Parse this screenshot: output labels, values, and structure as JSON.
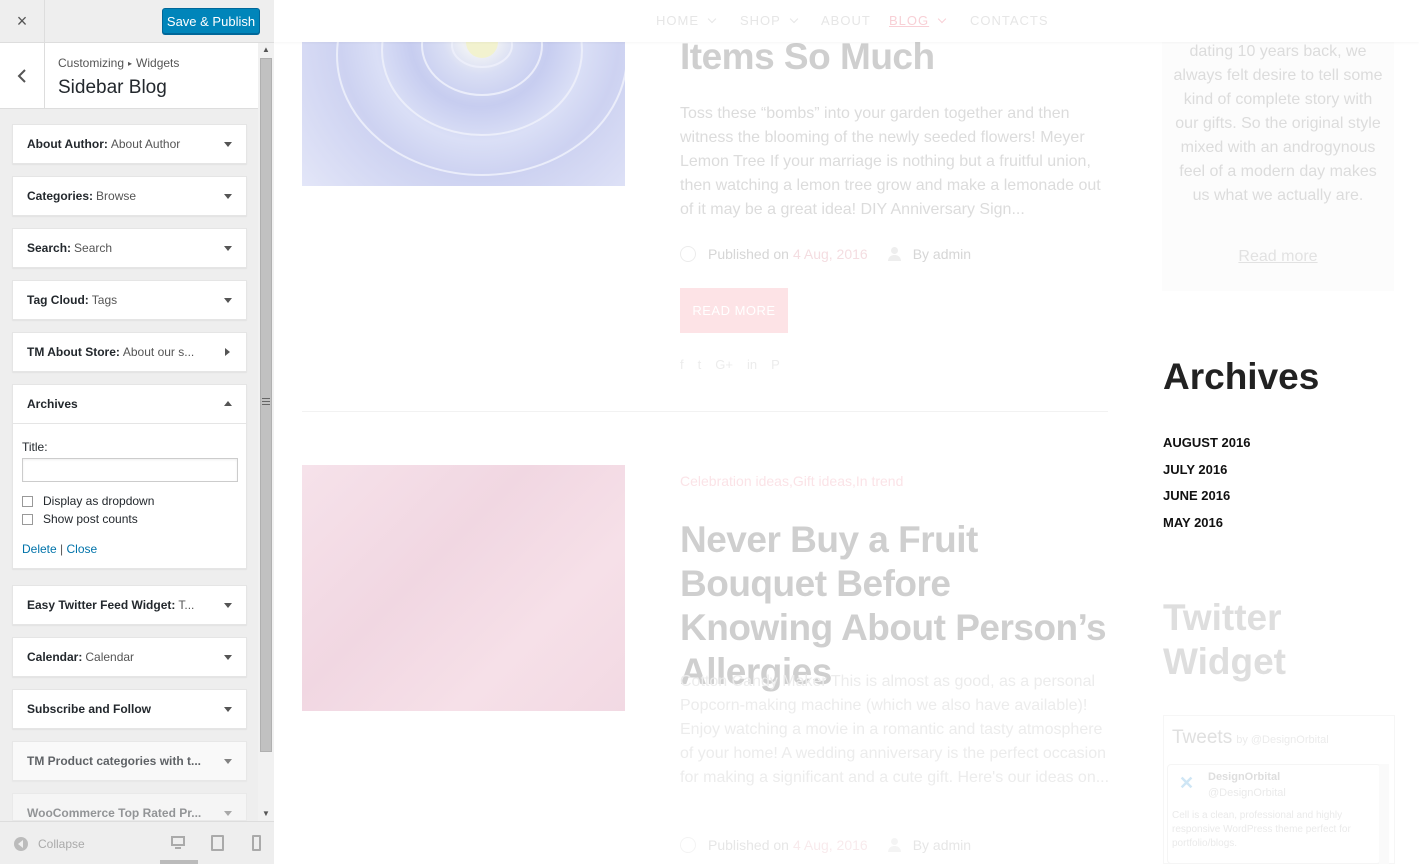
{
  "customizer": {
    "close_icon": "×",
    "publish_label": "Save & Publish",
    "breadcrumb": {
      "root": "Customizing",
      "separator": "▸",
      "current": "Widgets"
    },
    "section_title": "Sidebar Blog",
    "widgets": [
      {
        "name": "About Author:",
        "sub": "About Author",
        "state": "collapsed"
      },
      {
        "name": "Categories:",
        "sub": "Browse",
        "state": "collapsed"
      },
      {
        "name": "Search:",
        "sub": "Search",
        "state": "collapsed"
      },
      {
        "name": "Tag Cloud:",
        "sub": "Tags",
        "state": "collapsed"
      },
      {
        "name": "TM About Store:",
        "sub": "About our s...",
        "state": "right"
      },
      {
        "name": "Archives",
        "sub": "",
        "state": "expanded"
      },
      {
        "name": "Easy Twitter Feed Widget:",
        "sub": "T...",
        "state": "collapsed"
      },
      {
        "name": "Calendar:",
        "sub": "Calendar",
        "state": "collapsed"
      },
      {
        "name": "Subscribe and Follow",
        "sub": "",
        "state": "collapsed"
      },
      {
        "name": "TM Product categories with t...",
        "sub": "",
        "state": "collapsed"
      },
      {
        "name": "WooCommerce Top Rated Pr...",
        "sub": "",
        "state": "collapsed"
      }
    ],
    "archives_form": {
      "title_label": "Title:",
      "title_value": "",
      "dropdown_label": "Display as dropdown",
      "dropdown_checked": false,
      "counts_label": "Show post counts",
      "counts_checked": false,
      "delete_label": "Delete",
      "link_separator": "|",
      "close_label": "Close"
    },
    "footer": {
      "collapse_label": "Collapse",
      "devices": [
        "desktop-icon",
        "tablet-icon",
        "mobile-icon"
      ],
      "active_device": "desktop"
    }
  },
  "preview": {
    "nav": [
      {
        "label": "HOME",
        "dropdown": true
      },
      {
        "label": "SHOP",
        "dropdown": true
      },
      {
        "label": "ABOUT",
        "dropdown": false
      },
      {
        "label": "BLOG",
        "dropdown": true,
        "active": true
      },
      {
        "label": "CONTACTS",
        "dropdown": false
      }
    ],
    "post1": {
      "title": "Items So Much",
      "excerpt": "Toss these “bombs” into your garden together and then witness the blooming of the newly seeded flowers!  Meyer Lemon Tree If your marriage is nothing but a fruitful union, then watching a lemon tree grow and make a lemonade out of it may be a great idea!  DIY Anniversary Sign...",
      "published_label": "Published on",
      "date": "4 Aug, 2016",
      "author": "By admin",
      "read_more": "READ MORE",
      "share_icons": [
        "facebook-icon",
        "twitter-icon",
        "google-plus-icon",
        "linkedin-icon",
        "pinterest-icon"
      ],
      "share_glyphs": [
        "f",
        "t",
        "G+",
        "in",
        "P"
      ]
    },
    "post2": {
      "categories": "Celebration ideas,Gift ideas,In trend",
      "title": "Never Buy a Fruit Bouquet Before Knowing About Person’s Allergies",
      "excerpt": "Cotton Candy Maker This is almost as good, as a personal Popcorn-making machine (which we also have available)! Enjoy watching a movie in a romantic and tasty atmosphere of your home! A wedding anniversary is the perfect occasion for making a significant and a cute gift. Here's our ideas on...",
      "published_label": "Published on",
      "date": "4 Aug, 2016",
      "author": "By admin"
    },
    "about": {
      "text": "dating 10 years back, we always felt desire to tell some kind of complete story with our gifts. So the original style mixed with an androgynous feel of a modern day makes us what we actually are.",
      "read_more": "Read more"
    },
    "archives": {
      "title": "Archives",
      "items": [
        "AUGUST 2016",
        "JULY 2016",
        "JUNE 2016",
        "MAY 2016"
      ]
    },
    "twitter": {
      "title": "Twitter Widget",
      "tweets_label": "Tweets",
      "by_label": "by @DesignOrbital",
      "account_name": "DesignOrbital",
      "account_handle": "@DesignOrbital",
      "tweet_text": "Cell is a clean, professional and highly responsive WordPress theme perfect for portfolio/blogs."
    }
  }
}
